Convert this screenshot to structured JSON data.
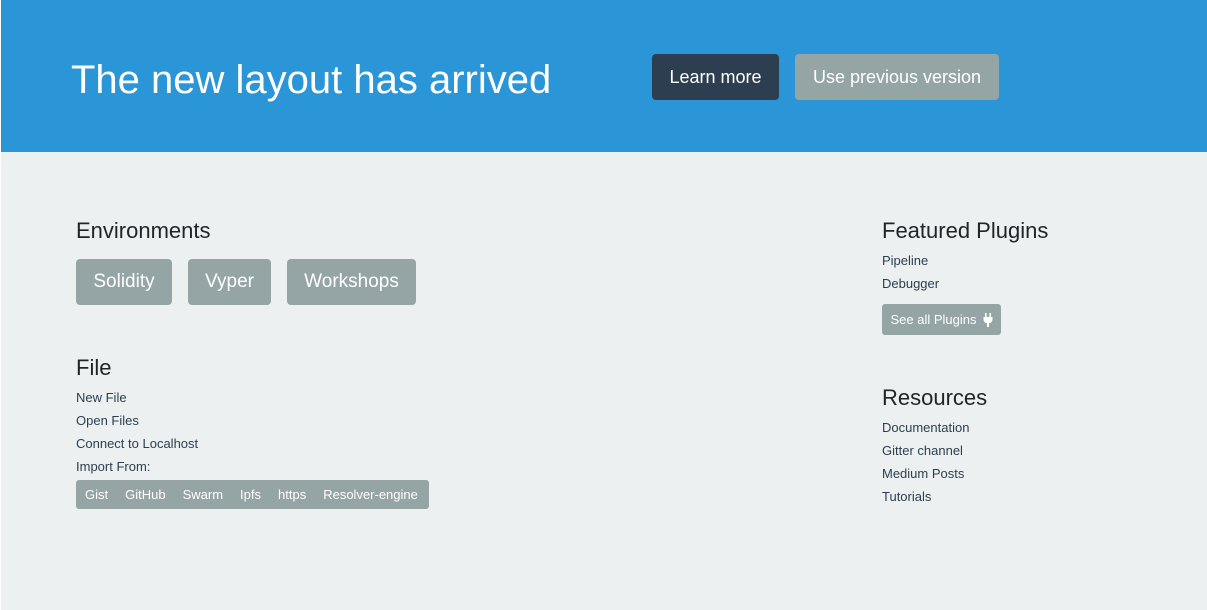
{
  "banner": {
    "title": "The new layout has arrived",
    "learn_more_label": "Learn more",
    "previous_version_label": "Use previous version",
    "background_color": "#2a96d7",
    "dark_button_color": "#2c3e50",
    "muted_button_color": "#95a5a6"
  },
  "environments": {
    "heading": "Environments",
    "items": [
      "Solidity",
      "Vyper",
      "Workshops"
    ]
  },
  "file": {
    "heading": "File",
    "links": [
      "New File",
      "Open Files",
      "Connect to Localhost"
    ],
    "import_label": "Import From:",
    "import_sources": [
      "Gist",
      "GitHub",
      "Swarm",
      "Ipfs",
      "https",
      "Resolver-engine"
    ]
  },
  "featured_plugins": {
    "heading": "Featured Plugins",
    "items": [
      "Pipeline",
      "Debugger"
    ],
    "see_all_label": "See all Plugins",
    "see_all_icon": "plug-icon"
  },
  "resources": {
    "heading": "Resources",
    "items": [
      "Documentation",
      "Gitter channel",
      "Medium Posts",
      "Tutorials"
    ]
  }
}
